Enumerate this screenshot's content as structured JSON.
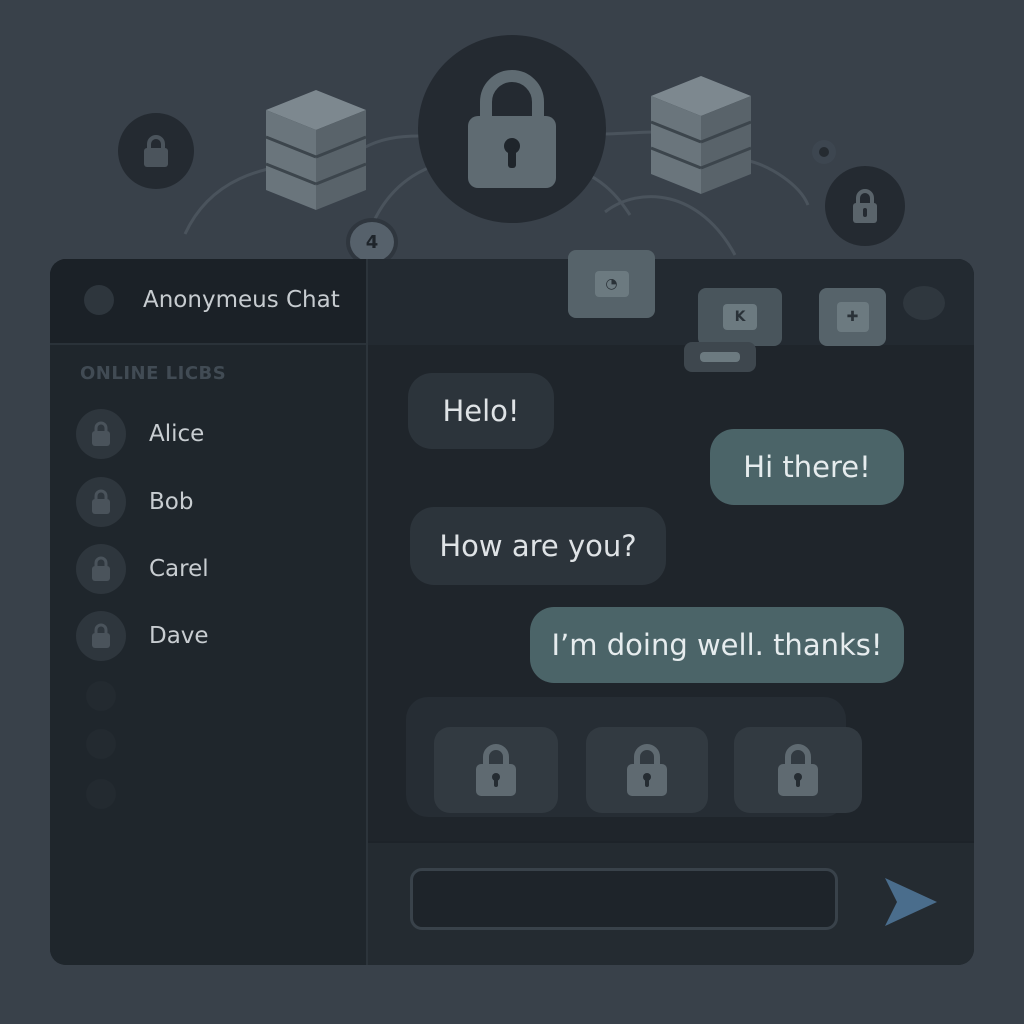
{
  "app": {
    "title": "Anonymeus Chat"
  },
  "decor": {
    "badge_count": "4"
  },
  "sidebar": {
    "section_label": "ONLINE LICBS",
    "users": [
      {
        "name": "Alice",
        "avatar_icon": "lock-icon"
      },
      {
        "name": "Bob",
        "avatar_icon": "lock-icon"
      },
      {
        "name": "Carel",
        "avatar_icon": "lock-icon"
      },
      {
        "name": "Dave",
        "avatar_icon": "lock-icon"
      }
    ]
  },
  "messages": [
    {
      "text": "Helo!",
      "direction": "incoming"
    },
    {
      "text": "Hi there!",
      "direction": "outgoing"
    },
    {
      "text": "How are you?",
      "direction": "incoming"
    },
    {
      "text": "I’m doing well. thanks!",
      "direction": "outgoing"
    }
  ],
  "composer": {
    "value": "",
    "placeholder": "",
    "send_icon": "send-icon"
  },
  "colors": {
    "background": "#39414a",
    "window": "#1d2329",
    "incoming_bubble": "#2c343b",
    "outgoing_bubble": "#4b6468",
    "send_accent": "#4a6d8c"
  }
}
